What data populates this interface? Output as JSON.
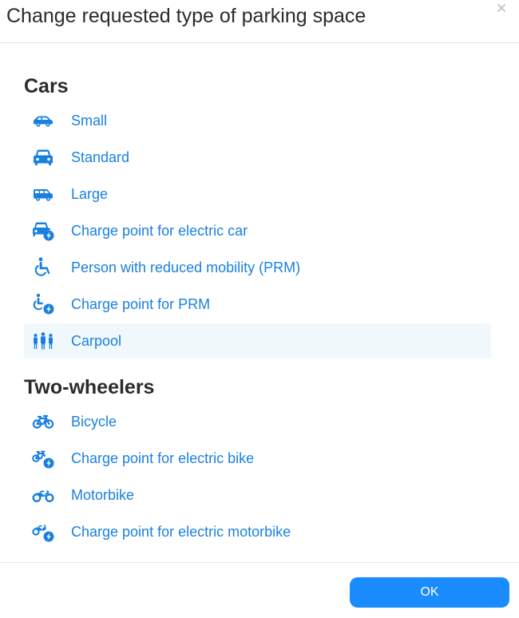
{
  "dialog": {
    "title": "Change requested type of parking space",
    "close_icon": "close-icon"
  },
  "colors": {
    "accent": "#1a80e0",
    "selected_background": "#f0f8fc",
    "button": "#1a8cff"
  },
  "sections": [
    {
      "title": "Cars",
      "options": [
        {
          "label": "Small",
          "icon": "small-car-icon",
          "selected": false
        },
        {
          "label": "Standard",
          "icon": "standard-car-icon",
          "selected": false
        },
        {
          "label": "Large",
          "icon": "large-car-icon",
          "selected": false
        },
        {
          "label": "Charge point for electric car",
          "icon": "electric-car-icon",
          "selected": false
        },
        {
          "label": "Person with reduced mobility (PRM)",
          "icon": "wheelchair-icon",
          "selected": false
        },
        {
          "label": "Charge point for PRM",
          "icon": "electric-wheelchair-icon",
          "selected": false
        },
        {
          "label": "Carpool",
          "icon": "carpool-icon",
          "selected": true
        }
      ]
    },
    {
      "title": "Two-wheelers",
      "options": [
        {
          "label": "Bicycle",
          "icon": "bicycle-icon",
          "selected": false
        },
        {
          "label": "Charge point for electric bike",
          "icon": "electric-bike-icon",
          "selected": false
        },
        {
          "label": "Motorbike",
          "icon": "motorbike-icon",
          "selected": false
        },
        {
          "label": "Charge point for electric motorbike",
          "icon": "electric-motorbike-icon",
          "selected": false
        }
      ]
    }
  ],
  "footer": {
    "ok_label": "OK"
  }
}
